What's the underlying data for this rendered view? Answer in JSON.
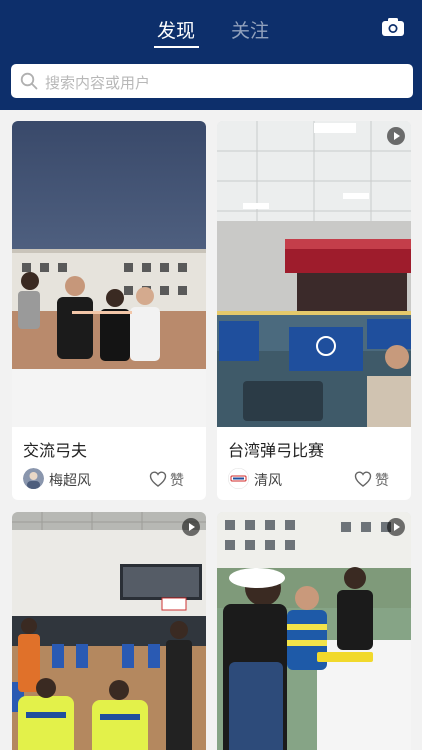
{
  "header": {
    "tabs": [
      {
        "label": "发现",
        "active": true
      },
      {
        "label": "关注",
        "active": false
      }
    ],
    "camera_icon": "camera-icon",
    "background": "#0d2f6b"
  },
  "search": {
    "placeholder": "搜索内容或用户",
    "icon": "search-icon"
  },
  "feed": [
    {
      "title": "交流弓夫",
      "author": "梅超风",
      "like_label": "赞",
      "has_video": false
    },
    {
      "title": "台湾弹弓比赛",
      "author": "清风",
      "like_label": "赞",
      "has_video": true
    },
    {
      "title": "",
      "author": "",
      "like_label": "",
      "has_video": true
    },
    {
      "title": "",
      "author": "",
      "like_label": "",
      "has_video": true
    }
  ]
}
